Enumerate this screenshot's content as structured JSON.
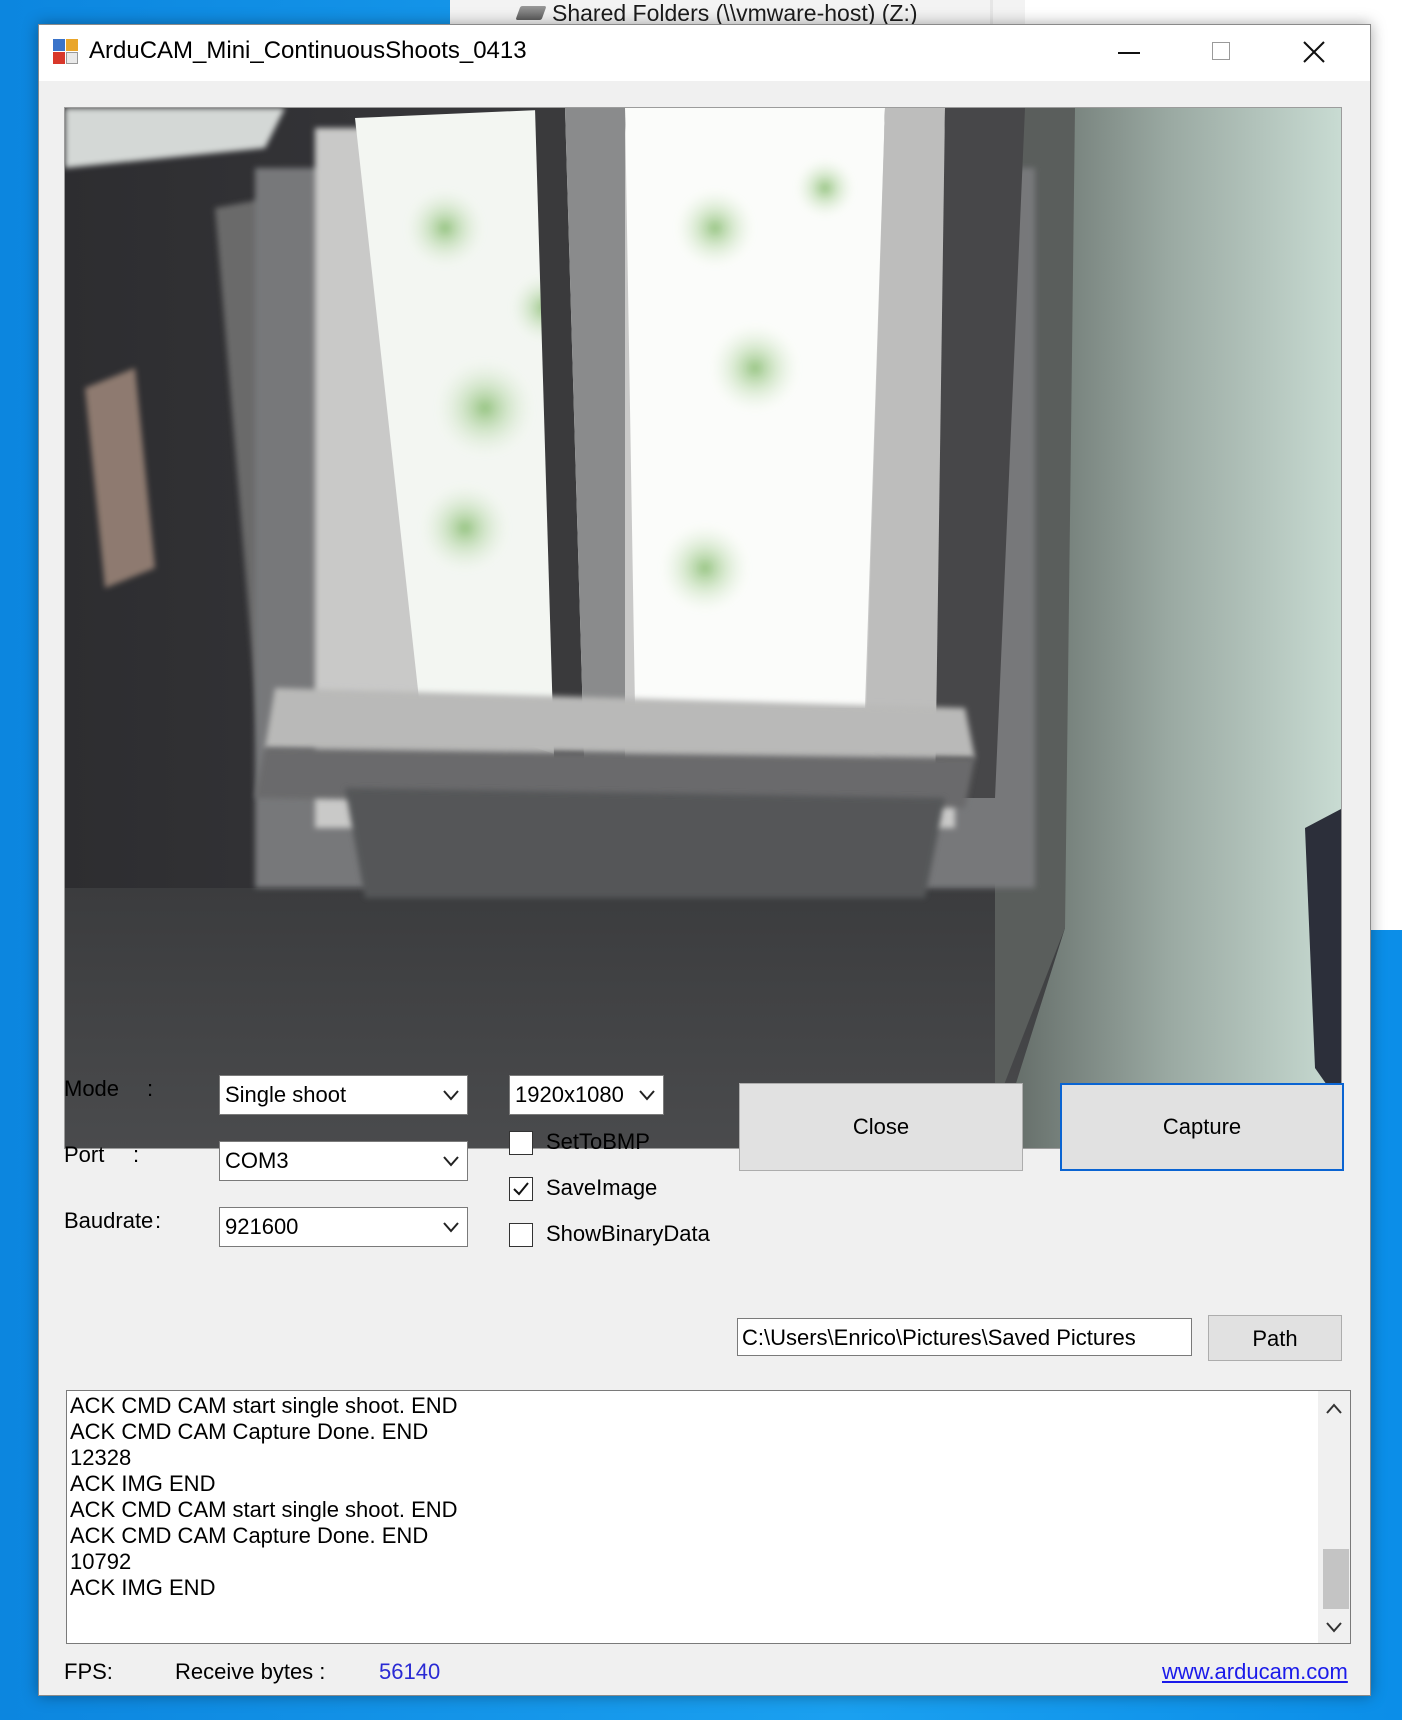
{
  "background": {
    "explorer_item_label": "Shared Folders (\\\\vmware-host) (Z:)",
    "explorer_item_icon": "network-drive-icon"
  },
  "window": {
    "title": "ArduCAM_Mini_ContinuousShoots_0413",
    "icon": "app-icon",
    "controls": {
      "minimize": "minimize-icon",
      "maximize": "maximize-icon",
      "close": "close-icon"
    }
  },
  "preview": {
    "description_icon": "camera-preview-image"
  },
  "settings": {
    "mode_label": "Mode",
    "port_label": "Port",
    "baudrate_label": "Baudrate",
    "colon": ":",
    "mode_value": "Single shoot",
    "port_value": "COM3",
    "baudrate_value": "921600",
    "resolution_value": "1920x1080"
  },
  "options": {
    "set_to_bmp": {
      "label": "SetToBMP",
      "checked": false
    },
    "save_image": {
      "label": "SaveImage",
      "checked": true
    },
    "show_binary": {
      "label": "ShowBinaryData",
      "checked": false
    }
  },
  "buttons": {
    "close_label": "Close",
    "capture_label": "Capture",
    "path_label": "Path"
  },
  "path_value": "C:\\Users\\Enrico\\Pictures\\Saved Pictures",
  "log_lines": [
    "ACK CMD CAM start single shoot. END",
    "ACK CMD CAM Capture Done. END",
    "12328",
    "ACK IMG END",
    "ACK CMD CAM start single shoot. END",
    "ACK CMD CAM Capture Done. END",
    "10792",
    "ACK IMG END"
  ],
  "status": {
    "fps_label": "FPS:",
    "receive_label": "Receive bytes :",
    "receive_value": "56140",
    "link_text": "www.arducam.com"
  },
  "colors": {
    "link": "#1a1aea",
    "value": "#2a2ad4",
    "focus_border": "#0a64d2"
  }
}
